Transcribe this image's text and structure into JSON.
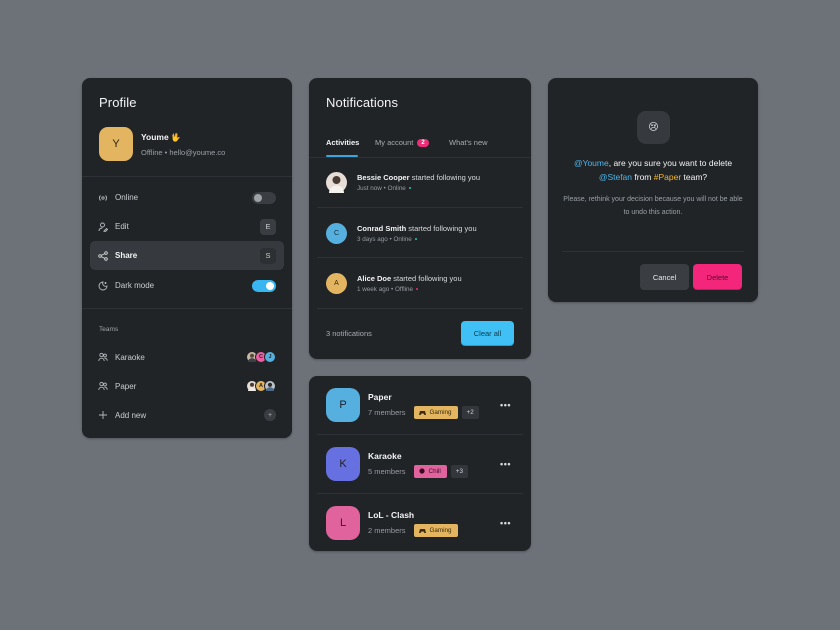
{
  "colors": {
    "background": "#6d7178",
    "card": "#212427",
    "accent_blue": "#3fc1f6",
    "accent_pink": "#f4267c",
    "accent_gold": "#e3b560",
    "online": "#2ec4b6",
    "offline": "#ec2d7a"
  },
  "profile": {
    "title": "Profile",
    "user": {
      "initial": "Y",
      "name": "Youme",
      "emoji": "🖖",
      "status": "Offline",
      "email": "hello@youme.co"
    },
    "menu": [
      {
        "icon": "broadcast-icon",
        "label": "Online",
        "control": "toggle",
        "toggle_on": false
      },
      {
        "icon": "user-edit-icon",
        "label": "Edit",
        "control": "shortcut",
        "shortcut": "E"
      },
      {
        "icon": "share-icon",
        "label": "Share",
        "control": "shortcut",
        "shortcut": "S",
        "active": true
      },
      {
        "icon": "moon-icon",
        "label": "Dark mode",
        "control": "toggle",
        "toggle_on": true
      }
    ],
    "teams_label": "Teams",
    "teams": [
      {
        "icon": "users-icon",
        "label": "Karaoke",
        "members": [
          {
            "initial": "",
            "color": "#c9b7a6",
            "kind": "photo"
          },
          {
            "initial": "C",
            "color": "#ec5fa2",
            "kind": "initial"
          },
          {
            "initial": "J",
            "color": "#55b0e0",
            "kind": "initial"
          }
        ]
      },
      {
        "icon": "users-icon",
        "label": "Paper",
        "members": [
          {
            "initial": "",
            "color": "#e6ddd6",
            "kind": "photo"
          },
          {
            "initial": "A",
            "color": "#e3b560",
            "kind": "initial"
          },
          {
            "initial": "",
            "color": "#b9c3cc",
            "kind": "photo"
          }
        ]
      }
    ],
    "add_new": {
      "icon": "plus-icon",
      "label": "Add new",
      "button_icon": "+"
    }
  },
  "notifications": {
    "title": "Notifications",
    "tabs": [
      {
        "label": "Activities",
        "active": true
      },
      {
        "label": "My account",
        "badge": "2"
      },
      {
        "label": "What's new"
      }
    ],
    "items": [
      {
        "name": "Bessie Cooper",
        "action": "started following you",
        "time": "Just now",
        "status": "Online",
        "avatar_kind": "photo",
        "avatar_color": "#e6ddd6",
        "initial": ""
      },
      {
        "name": "Conrad Smith",
        "action": "started following you",
        "time": "3 days ago",
        "status": "Online",
        "avatar_kind": "initial",
        "avatar_color": "#55b0e0",
        "initial": "C"
      },
      {
        "name": "Alice Doe",
        "action": "started following you",
        "time": "1 week ago",
        "status": "Offline",
        "avatar_kind": "initial",
        "avatar_color": "#e3b560",
        "initial": "A"
      }
    ],
    "count_label": "3 notifications",
    "clear_label": "Clear all"
  },
  "dialog": {
    "emoji": "😢",
    "mention_user": "@Youme",
    "question_part1": ", are you sure you want to delete",
    "mention_target": "@Stefan",
    "question_part2": " from ",
    "hashtag": "#Paper",
    "question_part3": " team?",
    "description": "Please, rethink your decision because you will not be able to undo this action.",
    "cancel_label": "Cancel",
    "delete_label": "Delete"
  },
  "teams_list": [
    {
      "initial": "P",
      "name": "Paper",
      "members": "7 members",
      "tag": "Gaming",
      "tag_icon": "🎮",
      "tag_color": "#e3b560",
      "extra": "+2",
      "avatar_color": "#55b0e0"
    },
    {
      "initial": "K",
      "name": "Karaoke",
      "members": "5 members",
      "tag": "Chill",
      "tag_icon": "●",
      "tag_color": "#e0639e",
      "extra": "+3",
      "avatar_color": "#6670e0"
    },
    {
      "initial": "L",
      "name": "LoL - Clash",
      "members": "2 members",
      "tag": "Gaming",
      "tag_icon": "🎮",
      "tag_color": "#e3b560",
      "extra": null,
      "avatar_color": "#e0639e"
    }
  ],
  "more_icon": "•••"
}
